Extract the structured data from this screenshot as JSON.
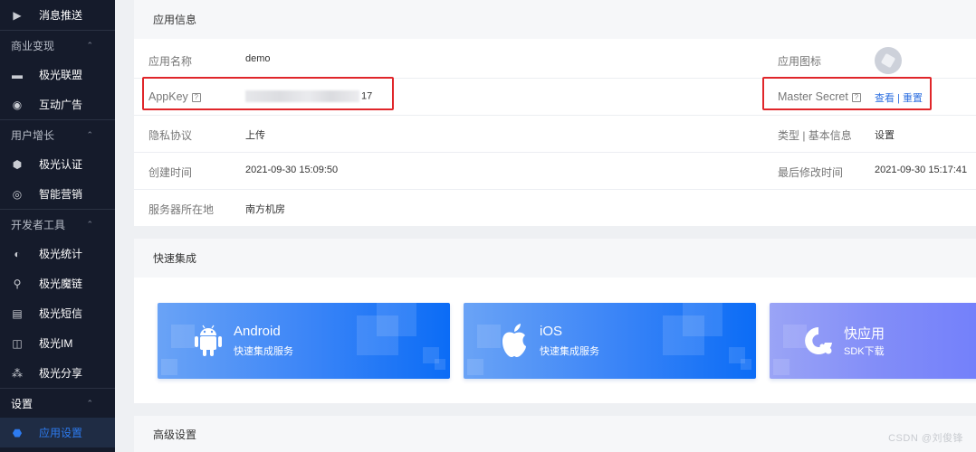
{
  "sidebar": {
    "items": [
      {
        "type": "item",
        "icon": "send-icon",
        "glyph": "▶",
        "label": "消息推送"
      },
      {
        "type": "group",
        "label": "商业变现",
        "chevron": "⌃"
      },
      {
        "type": "item",
        "icon": "wallet-icon",
        "glyph": "▬",
        "label": "极光联盟"
      },
      {
        "type": "item",
        "icon": "ad-target-icon",
        "glyph": "◉",
        "label": "互动广告"
      },
      {
        "type": "group",
        "label": "用户增长",
        "chevron": "⌃"
      },
      {
        "type": "item",
        "icon": "shield-icon",
        "glyph": "⬢",
        "label": "极光认证"
      },
      {
        "type": "item",
        "icon": "target-icon",
        "glyph": "◎",
        "label": "智能营销"
      },
      {
        "type": "group",
        "label": "开发者工具",
        "chevron": "⌃"
      },
      {
        "type": "item",
        "icon": "pie-chart-icon",
        "glyph": "◐",
        "label": "极光统计"
      },
      {
        "type": "item",
        "icon": "link-icon",
        "glyph": "⚲",
        "label": "极光魔链"
      },
      {
        "type": "item",
        "icon": "message-icon",
        "glyph": "▤",
        "label": "极光短信"
      },
      {
        "type": "item",
        "icon": "chat-icon",
        "glyph": "◫",
        "label": "极光IM"
      },
      {
        "type": "item",
        "icon": "share-icon",
        "glyph": "⁂",
        "label": "极光分享"
      },
      {
        "type": "group",
        "label": "设置",
        "chevron": "⌃",
        "bright": true
      },
      {
        "type": "item",
        "icon": "gear-icon",
        "glyph": "⬣",
        "label": "应用设置",
        "active": true
      }
    ]
  },
  "app_info": {
    "title": "应用信息",
    "rows": [
      {
        "label": "应用名称",
        "value": "demo",
        "label2": "应用图标"
      },
      {
        "label": "AppKey",
        "value_suffix": "17",
        "label2": "Master Secret",
        "view_link": "查看",
        "separator": "|",
        "reset_link": "重置"
      },
      {
        "label": "隐私协议",
        "link": "上传",
        "label2": "类型 | 基本信息",
        "link2": "设置"
      },
      {
        "label": "创建时间",
        "value": "2021-09-30 15:09:50",
        "label2": "最后修改时间",
        "value2": "2021-09-30 15:17:41"
      },
      {
        "label": "服务器所在地",
        "value": "南方机房"
      }
    ],
    "help_glyph": "?"
  },
  "quick_integration": {
    "title": "快速集成",
    "cards": [
      {
        "title": "Android",
        "subtitle": "快速集成服务"
      },
      {
        "title": "iOS",
        "subtitle": "快速集成服务"
      },
      {
        "title": "快应用",
        "subtitle": "SDK下载"
      }
    ]
  },
  "advanced": {
    "title": "高级设置"
  },
  "watermark": "CSDN @刘俊锋",
  "colors": {
    "accent": "#2d6fe0",
    "sidebar_bg": "#151b2b",
    "highlight_box": "#e0262a"
  }
}
